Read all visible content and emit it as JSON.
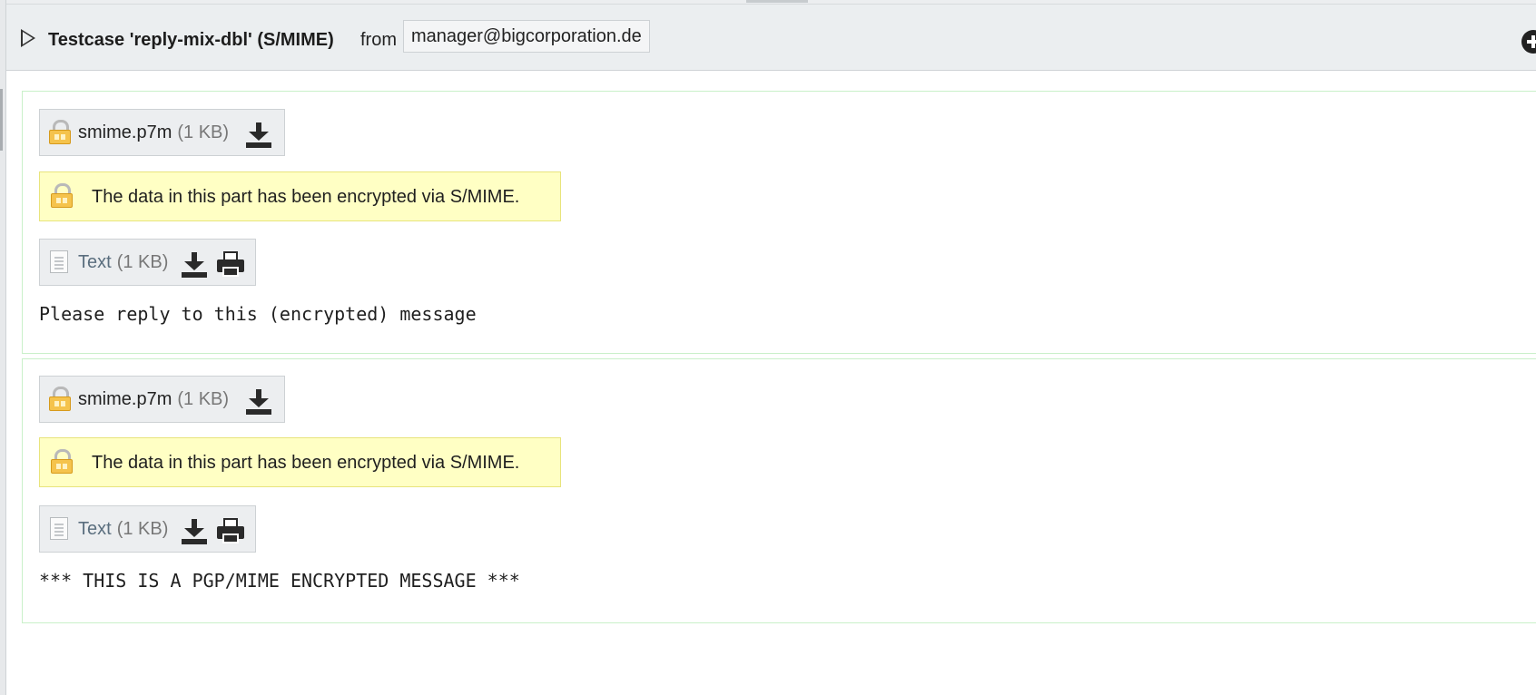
{
  "header": {
    "subject": "Testcase 'reply-mix-dbl' (S/MIME)",
    "from_label": "from",
    "from_address": "manager@bigcorporation.de"
  },
  "parts": [
    {
      "attachment": {
        "name": "smime.p7m",
        "size": "(1 KB)"
      },
      "notice": "The data in this part has been encrypted via S/MIME.",
      "text_attachment": {
        "name": "Text",
        "size": "(1 KB)"
      },
      "body": "Please reply to this (encrypted) message"
    },
    {
      "attachment": {
        "name": "smime.p7m",
        "size": "(1 KB)"
      },
      "notice": "The data in this part has been encrypted via S/MIME.",
      "text_attachment": {
        "name": "Text",
        "size": "(1 KB)"
      },
      "body": "*** THIS IS A PGP/MIME ENCRYPTED MESSAGE ***"
    }
  ],
  "icons": {
    "toggle": "expand-triangle-icon",
    "add": "plus-circle-icon",
    "lock": "lock-icon",
    "text": "document-icon",
    "download": "download-icon",
    "print": "printer-icon"
  },
  "colors": {
    "header_bg": "#ebeef0",
    "notice_bg": "#ffffc4",
    "part_border": "#c9f0c9",
    "lock_body": "#f5c34c"
  }
}
